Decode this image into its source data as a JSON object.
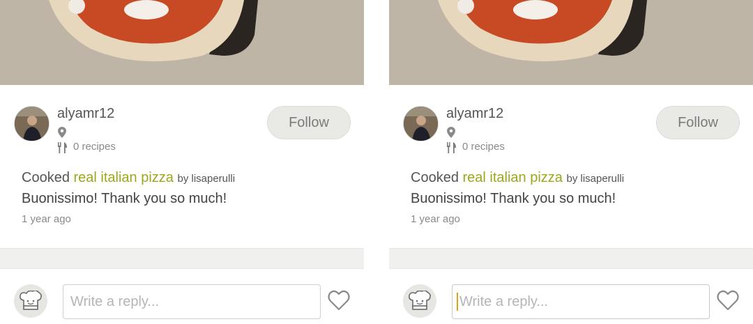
{
  "panels": [
    {
      "post": {
        "username": "alyamr12",
        "recipes_count": "0 recipes",
        "follow_label": "Follow",
        "cooked_prefix": "Cooked",
        "recipe_title": "real italian pizza",
        "by_author": "by lisaperulli",
        "message": "Buonissimo! Thank you so much!",
        "timestamp": "1 year ago"
      },
      "reply": {
        "placeholder": "Write a reply..."
      }
    },
    {
      "post": {
        "username": "alyamr12",
        "recipes_count": "0 recipes",
        "follow_label": "Follow",
        "cooked_prefix": "Cooked",
        "recipe_title": "real italian pizza",
        "by_author": "by lisaperulli",
        "message": "Buonissimo! Thank you so much!",
        "timestamp": "1 year ago"
      },
      "reply": {
        "placeholder": "Write a reply..."
      }
    }
  ],
  "colors": {
    "accent_recipe": "#9ca81a",
    "follow_bg": "#e9e9e6",
    "caret": "#d9a41a"
  },
  "icons": [
    "location-pin-icon",
    "fork-knife-icon",
    "chef-hat-icon",
    "heart-outline-icon"
  ]
}
